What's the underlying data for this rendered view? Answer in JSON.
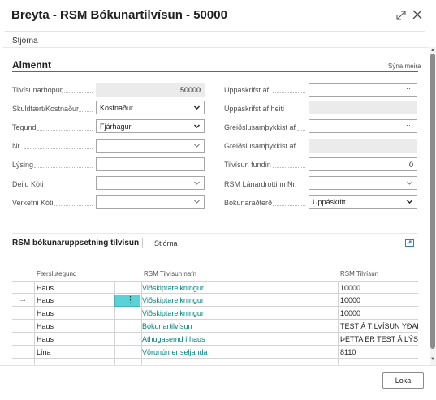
{
  "dialog": {
    "title": "Breyta - RSM Bókunartilvísun - 50000",
    "action_label": "Stjórna",
    "ok_label": "Loka"
  },
  "general": {
    "title": "Almennt",
    "show_more": "Sýna meira",
    "left": [
      {
        "label": "Tilvísunarhópur",
        "value": "50000",
        "kind": "readonly"
      },
      {
        "label": "Skuldfært/Kostnaður",
        "value": "Kostnaður",
        "kind": "select"
      },
      {
        "label": "Tegund",
        "value": "Fjárhagur",
        "kind": "select"
      },
      {
        "label": "Nr.",
        "value": "",
        "kind": "dropdown"
      },
      {
        "label": "Lýsing",
        "value": "",
        "kind": "text"
      },
      {
        "label": "Deild Kóti",
        "value": "",
        "kind": "dropdown"
      },
      {
        "label": "Verkefni Kóti",
        "value": "",
        "kind": "dropdown"
      }
    ],
    "right": [
      {
        "label": "Uppáskrifst af",
        "value": "",
        "kind": "lookup"
      },
      {
        "label": "Uppáskrifst af heiti",
        "value": "",
        "kind": "readonly"
      },
      {
        "label": "Greiðslusamþykkist af",
        "value": "",
        "kind": "lookup"
      },
      {
        "label": "Greiðslusamþykkist af ...",
        "value": "",
        "kind": "readonly"
      },
      {
        "label": "Tilvísun fundin",
        "value": "0",
        "kind": "number"
      },
      {
        "label": "RSM Lánardrottinn Nr.",
        "value": "",
        "kind": "dropdown"
      },
      {
        "label": "Bókunaraðferð",
        "value": "Uppáskrift",
        "kind": "select"
      }
    ]
  },
  "lines": {
    "title": "RSM bókunaruppsetning tilvísun",
    "action_label": "Stjórna",
    "columns": [
      "Færslutegund",
      "RSM Tilvísun nafn",
      "RSM Tilvísun"
    ],
    "rows": [
      {
        "type": "Haus",
        "name": "Viðskiptareikningur",
        "ref": "10000"
      },
      {
        "type": "Haus",
        "name": "Viðskiptareikningur",
        "ref": "10000"
      },
      {
        "type": "Haus",
        "name": "Viðskiptareikningur",
        "ref": "10000"
      },
      {
        "type": "Haus",
        "name": "Bókunartilvísun",
        "ref": "TEST Á TILVÍSUN YÐAR"
      },
      {
        "type": "Haus",
        "name": "Athugasemd í haus",
        "ref": "ÞETTA ER TEST Á LÝSIN..."
      },
      {
        "type": "Lína",
        "name": "Vörunúmer seljanda",
        "ref": "8110"
      }
    ],
    "selected_row": 1
  },
  "colors": {
    "link": "#00827f",
    "selected_cell": "#5bd3d6"
  },
  "icons": [
    "expand-icon",
    "close-icon",
    "chevron-down-icon",
    "ellipsis-icon",
    "share-icon",
    "row-arrow-icon",
    "row-menu-icon"
  ]
}
